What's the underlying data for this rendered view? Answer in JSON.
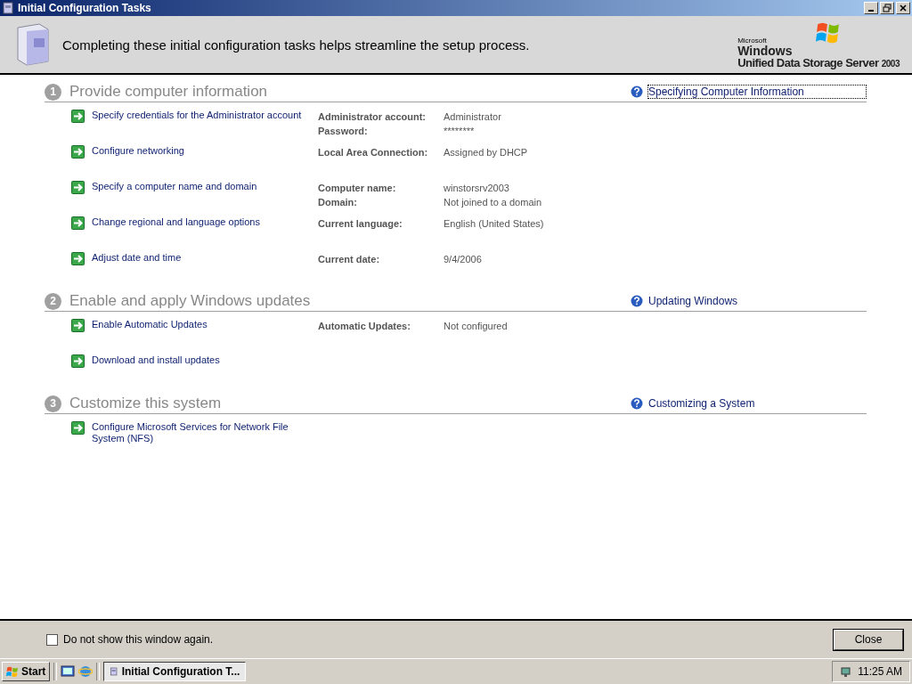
{
  "window": {
    "title": "Initial Configuration Tasks"
  },
  "header": {
    "text": "Completing these initial configuration tasks helps streamline the setup process.",
    "logo": {
      "maker": "Microsoft",
      "brand": "Windows",
      "product": "Unified Data Storage Server",
      "version": "2003"
    }
  },
  "sections": [
    {
      "number": "1",
      "title": "Provide computer information",
      "help": "Specifying Computer Information",
      "help_focused": true,
      "tasks": [
        {
          "label": "Specify credentials for the Administrator account",
          "details": [
            {
              "name": "Administrator account:",
              "value": "Administrator"
            },
            {
              "name": "Password:",
              "value": "********"
            }
          ]
        },
        {
          "label": "Configure networking",
          "details": [
            {
              "name": "Local Area Connection:",
              "value": "Assigned by DHCP"
            }
          ]
        },
        {
          "label": "Specify a computer name and domain",
          "details": [
            {
              "name": "Computer name:",
              "value": "winstorsrv2003"
            },
            {
              "name": "Domain:",
              "value": "Not joined to a domain"
            }
          ]
        },
        {
          "label": "Change regional and language options",
          "details": [
            {
              "name": "Current language:",
              "value": "English (United States)"
            }
          ]
        },
        {
          "label": "Adjust date and time",
          "details": [
            {
              "name": "Current date:",
              "value": "9/4/2006"
            }
          ]
        }
      ]
    },
    {
      "number": "2",
      "title": "Enable and apply Windows updates",
      "help": "Updating Windows",
      "help_focused": false,
      "tasks": [
        {
          "label": "Enable Automatic Updates",
          "details": [
            {
              "name": "Automatic Updates:",
              "value": "Not configured"
            }
          ]
        },
        {
          "label": "Download and install updates"
        }
      ]
    },
    {
      "number": "3",
      "title": "Customize this system",
      "help": "Customizing a System",
      "help_focused": false,
      "tasks": [
        {
          "label": "Configure Microsoft Services for Network File System (NFS)"
        }
      ]
    }
  ],
  "footer": {
    "checkbox": {
      "label": "Do not show this window again.",
      "checked": false
    },
    "close": "Close"
  },
  "taskbar": {
    "start": "Start",
    "task": "Initial Configuration T...",
    "clock": "11:25 AM"
  }
}
